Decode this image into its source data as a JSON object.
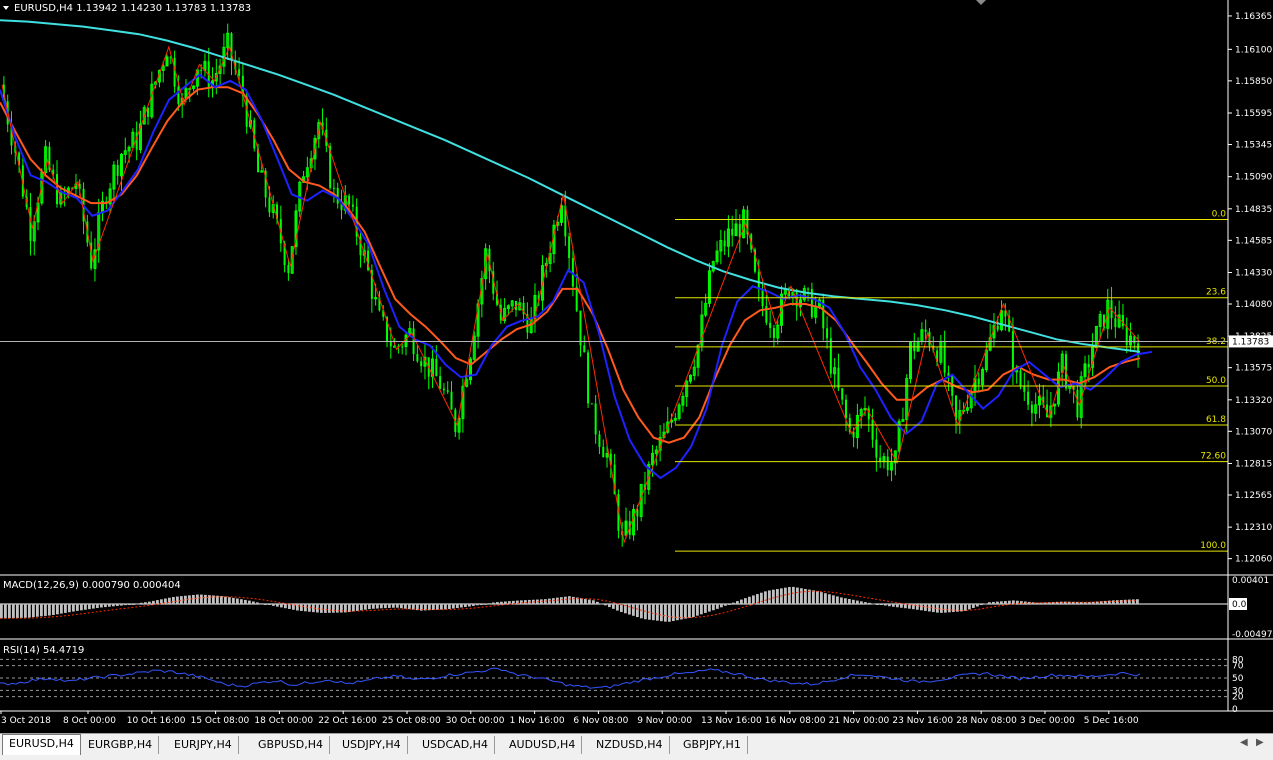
{
  "window": {
    "main_label": "EURUSD,H4  1.13942 1.14230 1.13783 1.13783",
    "macd_label": "MACD(12,26,9) 0.000790 0.000404",
    "rsi_label": "RSI(14) 54.4719",
    "current_price_label": "1.13783"
  },
  "tabs": [
    "EURUSD,H4",
    "EURGBP,H4",
    "EURJPY,H4",
    "GBPUSD,H4",
    "USDJPY,H4",
    "USDCAD,H4",
    "AUDUSD,H4",
    "NZDUSD,H4",
    "GBPJPY,H1"
  ],
  "active_tab": 0,
  "chart_data": {
    "type": "candlestick",
    "symbol": "EURUSD",
    "timeframe": "H4",
    "ohlc": {
      "open": 1.13942,
      "high": 1.1423,
      "low": 1.13783,
      "close": 1.13783
    },
    "price_axis_ticks": [
      "1.16365",
      "1.16100",
      "1.15850",
      "1.15595",
      "1.15345",
      "1.15090",
      "1.14835",
      "1.14585",
      "1.14330",
      "1.14080",
      "1.13825",
      "1.13575",
      "1.13320",
      "1.13070",
      "1.12815",
      "1.12565",
      "1.12310",
      "1.12060"
    ],
    "ylim": [
      1.1197,
      1.1642
    ],
    "time_axis_labels": [
      "3 Oct 2018",
      "8 Oct 00:00",
      "10 Oct 16:00",
      "15 Oct 08:00",
      "18 Oct 00:00",
      "22 Oct 16:00",
      "25 Oct 08:00",
      "30 Oct 00:00",
      "1 Nov 16:00",
      "6 Nov 08:00",
      "9 Nov 00:00",
      "13 Nov 16:00",
      "16 Nov 08:00",
      "21 Nov 00:00",
      "23 Nov 16:00",
      "28 Nov 08:00",
      "3 Dec 00:00",
      "5 Dec 16:00"
    ],
    "price_path": [
      1.1582,
      1.153,
      1.1468,
      1.1522,
      1.1488,
      1.1505,
      1.1442,
      1.1498,
      1.1528,
      1.1538,
      1.1575,
      1.1612,
      1.1566,
      1.1598,
      1.1585,
      1.1612,
      1.1574,
      1.1512,
      1.1478,
      1.1438,
      1.1515,
      1.1552,
      1.1495,
      1.1485,
      1.1445,
      1.1395,
      1.1372,
      1.1385,
      1.1362,
      1.1345,
      1.1312,
      1.1372,
      1.1448,
      1.1395,
      1.1408,
      1.1392,
      1.1442,
      1.1495,
      1.1405,
      1.1318,
      1.1288,
      1.1219,
      1.1245,
      1.1285,
      1.1308,
      1.1342,
      1.1375,
      1.1442,
      1.1462,
      1.1472,
      1.1412,
      1.1392,
      1.1422,
      1.1412,
      1.1402,
      1.1348,
      1.1305,
      1.1325,
      1.1285,
      1.1282,
      1.1372,
      1.1385,
      1.1368,
      1.1312,
      1.1342,
      1.1368,
      1.1408,
      1.1348,
      1.1332,
      1.1318,
      1.1358,
      1.1328,
      1.1375,
      1.1405,
      1.1385,
      1.1378
    ],
    "ma_fast_blue": [
      1.1578,
      1.154,
      1.151,
      1.1505,
      1.1497,
      1.1492,
      1.1478,
      1.1482,
      1.1498,
      1.1515,
      1.1545,
      1.157,
      1.158,
      1.159,
      1.158,
      1.1585,
      1.1578,
      1.1555,
      1.1525,
      1.1495,
      1.149,
      1.1498,
      1.1492,
      1.1475,
      1.1455,
      1.142,
      1.139,
      1.138,
      1.1375,
      1.136,
      1.135,
      1.1352,
      1.1375,
      1.139,
      1.1395,
      1.1398,
      1.141,
      1.1435,
      1.1425,
      1.1385,
      1.1335,
      1.13,
      1.128,
      1.127,
      1.1278,
      1.1295,
      1.1325,
      1.1375,
      1.141,
      1.1422,
      1.1418,
      1.1412,
      1.1415,
      1.1412,
      1.1405,
      1.1385,
      1.1358,
      1.134,
      1.1318,
      1.1305,
      1.1315,
      1.1345,
      1.1352,
      1.1338,
      1.1325,
      1.1335,
      1.1355,
      1.1362,
      1.1352,
      1.1342,
      1.1345,
      1.134,
      1.135,
      1.1362,
      1.1368,
      1.137
    ],
    "ma_mid_orange": [
      1.1568,
      1.1545,
      1.1523,
      1.151,
      1.15,
      1.1494,
      1.1488,
      1.1488,
      1.1495,
      1.151,
      1.1532,
      1.1553,
      1.1568,
      1.1578,
      1.158,
      1.158,
      1.1575,
      1.1558,
      1.1538,
      1.1515,
      1.1505,
      1.1502,
      1.1495,
      1.1482,
      1.1465,
      1.1438,
      1.1412,
      1.14,
      1.139,
      1.1378,
      1.1365,
      1.136,
      1.137,
      1.138,
      1.1388,
      1.1392,
      1.1402,
      1.142,
      1.142,
      1.14,
      1.1372,
      1.134,
      1.1318,
      1.1302,
      1.1298,
      1.1302,
      1.1318,
      1.1348,
      1.1375,
      1.1395,
      1.1403,
      1.1405,
      1.1408,
      1.1408,
      1.1405,
      1.1395,
      1.1378,
      1.1362,
      1.1345,
      1.1332,
      1.1332,
      1.1342,
      1.1348,
      1.1342,
      1.1338,
      1.134,
      1.1352,
      1.1358,
      1.1352,
      1.1348,
      1.1348,
      1.1345,
      1.135,
      1.1358,
      1.1362,
      1.1365
    ],
    "ma_slow_cyan": [
      1.1633,
      1.1632,
      1.163,
      1.1628,
      1.1625,
      1.1622,
      1.1617,
      1.1611,
      1.1604,
      1.1597,
      1.159,
      1.1582,
      1.1574,
      1.1565,
      1.1556,
      1.1547,
      1.1538,
      1.1528,
      1.1518,
      1.1508,
      1.1497,
      1.1486,
      1.1475,
      1.1464,
      1.1453,
      1.1443,
      1.1434,
      1.1427,
      1.1421,
      1.1417,
      1.1414,
      1.1412,
      1.141,
      1.1407,
      1.1403,
      1.1398,
      1.1392,
      1.1386,
      1.138,
      1.1376,
      1.1373,
      1.137
    ],
    "fibonacci": [
      {
        "level": "0.0",
        "price": 1.1475
      },
      {
        "level": "23.6",
        "price": 1.1413
      },
      {
        "level": "38.2",
        "price": 1.1374
      },
      {
        "level": "50.0",
        "price": 1.1343
      },
      {
        "level": "61.8",
        "price": 1.1312
      },
      {
        "level": "72.60",
        "price": 1.1283
      },
      {
        "level": "100.0",
        "price": 1.1212
      }
    ],
    "macd": {
      "label": "MACD(12,26,9)",
      "ticks": [
        "0.00401",
        "0.00",
        "-0.004975"
      ],
      "ylim": [
        -0.0055,
        0.0045
      ],
      "histogram": [
        -0.0024,
        -0.0023,
        -0.0019,
        -0.0012,
        -0.0006,
        -0.0002,
        0.0004,
        0.0012,
        0.0016,
        0.0013,
        0.0006,
        -0.0003,
        -0.0011,
        -0.0015,
        -0.0014,
        -0.0008,
        -0.0006,
        -0.0011,
        -0.0009,
        -0.0004,
        0.0003,
        0.0006,
        0.0008,
        0.0013,
        0.0006,
        -0.0012,
        -0.0025,
        -0.003,
        -0.0022,
        -0.0008,
        0.0008,
        0.0022,
        0.0029,
        0.0022,
        0.0011,
        0.0003,
        -0.0004,
        -0.0009,
        -0.0015,
        -0.0012,
        0.0003,
        0.0006,
        0.0002,
        0.0004,
        0.0003,
        0.0006,
        0.0008
      ]
    },
    "rsi": {
      "label": "RSI(14)",
      "ticks": [
        "80",
        "70",
        "50",
        "30",
        "20",
        "0"
      ],
      "levels": [
        80,
        70,
        50,
        30,
        20
      ],
      "ylim": [
        0,
        100
      ],
      "values": [
        40,
        42,
        47,
        50,
        44,
        49,
        52,
        55,
        58,
        62,
        60,
        55,
        49,
        40,
        37,
        42,
        46,
        39,
        43,
        48,
        41,
        44,
        50,
        53,
        47,
        50,
        55,
        58,
        62,
        65,
        55,
        51,
        45,
        38,
        35,
        34,
        40,
        46,
        51,
        56,
        58,
        63,
        60,
        55,
        48,
        45,
        42,
        40,
        45,
        53,
        56,
        52,
        48,
        44,
        46,
        50,
        55,
        58,
        53,
        49,
        52,
        55,
        54,
        52,
        55,
        58,
        55
      ]
    }
  },
  "colors": {
    "background": "#000000",
    "bull": "#00ff00",
    "ma_fast": "#1e22ff",
    "ma_mid": "#ff5a1e",
    "ma_slow": "#40e0e0",
    "zigzag": "#ff2a00",
    "fibonacci": "#e6e600",
    "rsi_line": "#3355ff"
  }
}
